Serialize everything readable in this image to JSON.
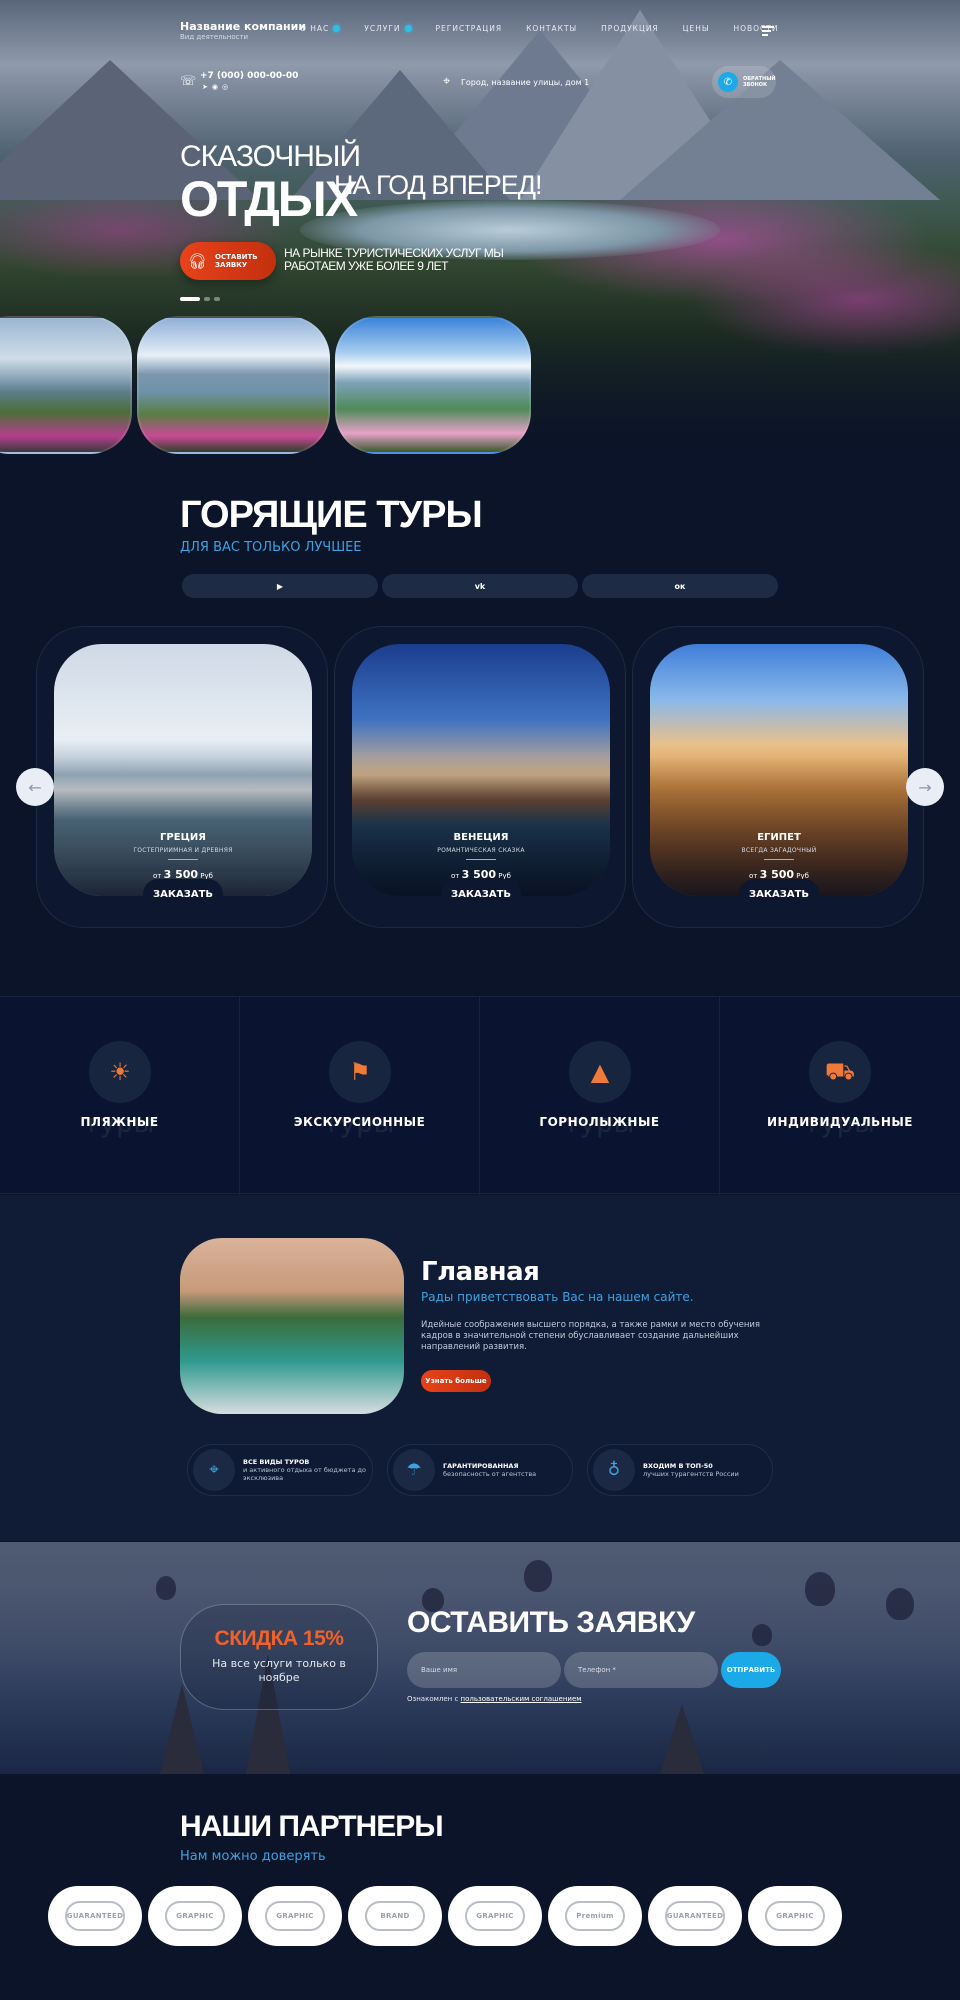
{
  "header": {
    "company_name": "Название компании",
    "company_sub": "Вид деятельности",
    "nav": [
      "О НАС",
      "УСЛУГИ",
      "РЕГИСТРАЦИЯ",
      "КОНТАКТЫ",
      "ПРОДУКЦИЯ",
      "ЦЕНЫ",
      "НОВОСТИ"
    ],
    "phone": "+7 (000) 000-00-00",
    "address": "Город, название улицы, дом 1",
    "callback": [
      "ОБРАТНЫЙ",
      "ЗВОНОК"
    ]
  },
  "hero": {
    "line1": "СКАЗОЧНЫЙ",
    "line2": "ОТДЫХ",
    "line3": "НА ГОД ВПЕРЕД!",
    "button": [
      "ОСТАВИТЬ",
      "ЗАЯВКУ"
    ],
    "note": "НА РЫНКЕ ТУРИСТИЧЕСКИХ УСЛУГ МЫ РАБОТАЕМ УЖЕ БОЛЕЕ 9 ЛЕТ"
  },
  "hot_tours": {
    "title": "ГОРЯЩИЕ ТУРЫ",
    "subtitle": "ДЛЯ ВАС ТОЛЬКО ЛУЧШЕЕ",
    "social_icons": [
      "youtube-icon",
      "vk-icon",
      "odnoklassniki-icon"
    ],
    "social_glyphs": [
      "▶",
      "vk",
      "ок"
    ],
    "cards": [
      {
        "name": "ГРЕЦИЯ",
        "desc": "ГОСТЕПРИИМНАЯ И ДРЕВНЯЯ",
        "price_from": "от",
        "price": "3 500",
        "currency": "Руб",
        "button": "ЗАКАЗАТЬ"
      },
      {
        "name": "ВЕНЕЦИЯ",
        "desc": "РОМАНТИЧЕСКАЯ СКАЗКА",
        "price_from": "от",
        "price": "3 500",
        "currency": "Руб",
        "button": "ЗАКАЗАТЬ"
      },
      {
        "name": "ЕГИПЕТ",
        "desc": "ВСЕГДА ЗАГАДОЧНЫЙ",
        "price_from": "от",
        "price": "3 500",
        "currency": "Руб",
        "button": "ЗАКАЗАТЬ"
      }
    ]
  },
  "categories": [
    {
      "title": "ПЛЯЖНЫЕ",
      "ghost": "туры",
      "icon": "sunset-icon"
    },
    {
      "title": "ЭКСКУРСИОННЫЕ",
      "ghost": "туры",
      "icon": "signpost-icon"
    },
    {
      "title": "ГОРНОЛЫЖНЫЕ",
      "ghost": "туры",
      "icon": "mountain-icon"
    },
    {
      "title": "ИНДИВИДУАЛЬНЫЕ",
      "ghost": "туры",
      "icon": "car-luggage-icon"
    }
  ],
  "about": {
    "title": "Главная",
    "subtitle": "Рады приветствовать Вас на нашем сайте.",
    "text": "Идейные соображения высшего порядка, а также рамки и место обучения кадров в значительной степени обуславливает создание дальнейших направлений развития.",
    "button": "Узнать больше",
    "features": [
      {
        "title": "ВСЕ ВИДЫ ТУРОВ",
        "text": "и активного отдыха от бюджета до эксклюзива",
        "icon": "map-pin-icon"
      },
      {
        "title": "ГАРАНТИРОВАННАЯ",
        "text": "безопасность от агентства",
        "icon": "beach-umbrella-icon"
      },
      {
        "title": "ВХОДИМ В ТОП-50",
        "text": "лучших турагентств России",
        "icon": "balloon-icon"
      }
    ]
  },
  "order": {
    "discount_title": "СКИДКА 15%",
    "discount_text": "На все услуги только в ноябре",
    "title": "ОСТАВИТЬ ЗАЯВКУ",
    "name_placeholder": "Ваше имя",
    "phone_placeholder": "Телефон *",
    "submit": "ОТПРАВИТЬ",
    "agree_prefix": "Ознакомлен с ",
    "agree_link": "пользовательским соглашением"
  },
  "partners": {
    "title": "НАШИ ПАРТНЕРЫ",
    "subtitle": "Нам можно доверять",
    "logos": [
      "GUARANTEED",
      "GRAPHIC",
      "GRAPHIC",
      "BRAND",
      "GRAPHIC",
      "Premium",
      "GUARANTEED",
      "GRAPHIC"
    ]
  },
  "colors": {
    "accent_orange": "#e8421a",
    "accent_blue": "#1ba9e8",
    "background": "#0b1428"
  }
}
